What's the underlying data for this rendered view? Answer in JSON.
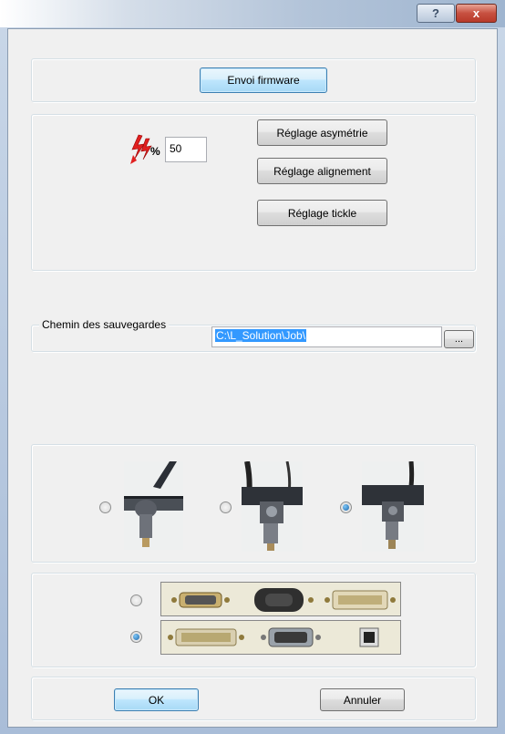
{
  "titlebar": {
    "help_glyph": "?",
    "close_glyph": "x"
  },
  "firmware": {
    "button_label": "Envoi firmware"
  },
  "adjust": {
    "percent_symbol": "%",
    "percent_value": "50",
    "asymmetry_label": "Réglage asymétrie",
    "alignment_label": "Réglage alignement",
    "tickle_label": "Réglage tickle"
  },
  "backup": {
    "group_label": "Chemin des sauvegardes",
    "path_value": "C:\\L_Solution\\Job\\",
    "browse_label": "..."
  },
  "tools": {
    "options": [
      {
        "icon": "drag-knife-tool-photo",
        "selected": false
      },
      {
        "icon": "tangential-cutter-tool-photo",
        "selected": false
      },
      {
        "icon": "pen-holder-tool-photo",
        "selected": true
      }
    ]
  },
  "ports": {
    "options": [
      {
        "icons": [
          "serial-db9-connector-icon",
          "ps2-adapter-icon",
          "parallel-centronics-connector-icon"
        ],
        "selected": false
      },
      {
        "icons": [
          "parallel-db25-connector-icon",
          "serial-db9-female-connector-icon",
          "usb-b-connector-icon"
        ],
        "selected": true
      }
    ]
  },
  "footer": {
    "ok_label": "OK",
    "cancel_label": "Annuler"
  },
  "colors": {
    "accent": "#3c7fb1",
    "lightning": "#e02020",
    "selection": "#3399ff"
  }
}
